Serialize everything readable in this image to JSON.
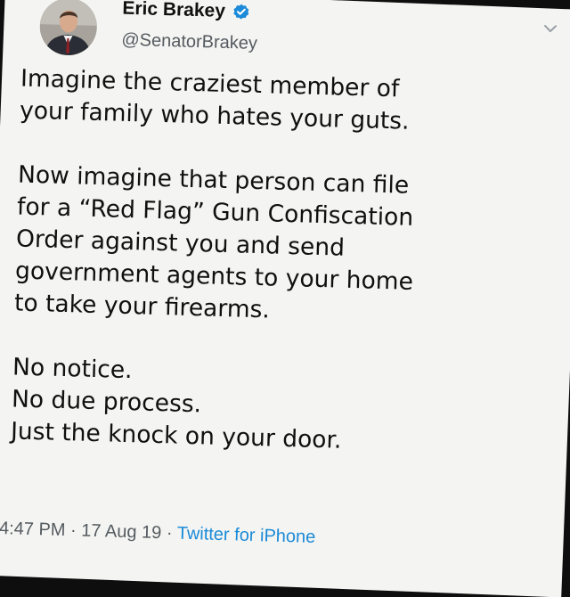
{
  "tweet": {
    "author": {
      "name": "Eric Brakey",
      "handle": "@SenatorBrakey",
      "verified_icon": "verified-badge-icon",
      "avatar_icon": "profile-photo"
    },
    "menu_icon": "chevron-down-icon",
    "paragraphs": [
      [
        "Imagine the craziest member of",
        "your family who hates your guts."
      ],
      [
        "Now imagine that person can file",
        "for a “Red Flag” Gun Confiscation",
        "Order against you and send",
        "government agents to your home",
        "to take your firearms."
      ],
      [
        "No notice.",
        "No due process.",
        "Just the knock on your door."
      ]
    ],
    "meta": {
      "time": "4:47 PM",
      "separator": " · ",
      "date": "17 Aug 19",
      "source": "Twitter for iPhone"
    }
  },
  "colors": {
    "accent_blue": "#1b8ad8",
    "text": "#101010",
    "secondary_text": "#555b60",
    "background": "#f4f4f2"
  }
}
